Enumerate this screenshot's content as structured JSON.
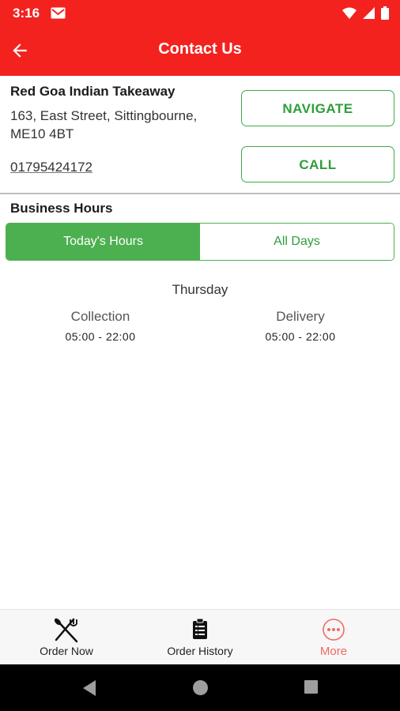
{
  "status_bar": {
    "time": "3:16"
  },
  "app_bar": {
    "title": "Contact Us"
  },
  "restaurant": {
    "name": "Red Goa Indian Takeaway",
    "address_line1": "163, East Street, Sittingbourne,",
    "address_line2": "ME10 4BT",
    "phone": "01795424172"
  },
  "actions": {
    "navigate_label": "NAVIGATE",
    "call_label": "CALL"
  },
  "business_hours": {
    "title": "Business Hours",
    "tabs": [
      {
        "label": "Today's Hours",
        "active": true
      },
      {
        "label": "All Days",
        "active": false
      }
    ],
    "day": "Thursday",
    "collection": {
      "label": "Collection",
      "hours": "05:00 - 22:00"
    },
    "delivery": {
      "label": "Delivery",
      "hours": "05:00 - 22:00"
    }
  },
  "bottom_nav": {
    "items": [
      {
        "label": "Order Now",
        "icon": "fork-knife-icon"
      },
      {
        "label": "Order History",
        "icon": "clipboard-icon"
      },
      {
        "label": "More",
        "icon": "more-dots-icon",
        "active": true
      }
    ]
  },
  "colors": {
    "primary_red": "#f3221f",
    "accent_green": "#4caf50",
    "more_active": "#f06a66"
  }
}
